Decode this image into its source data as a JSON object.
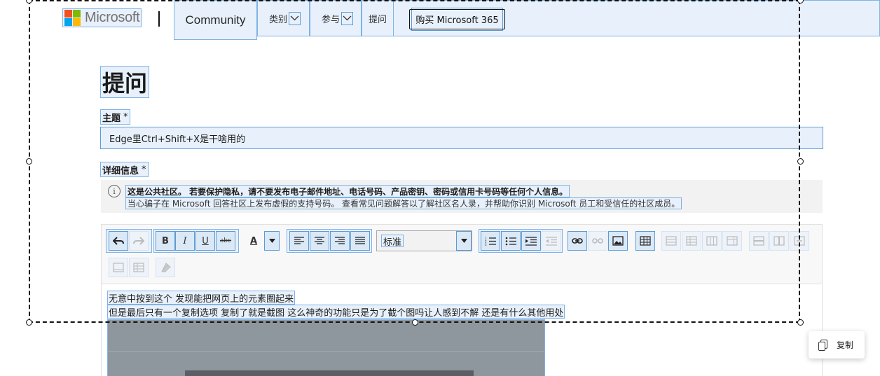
{
  "header": {
    "logo_text": "Microsoft",
    "nav": {
      "community": "Community",
      "categories": "类别",
      "participate": "参与",
      "ask": "提问",
      "buy": "购买 Microsoft 365"
    }
  },
  "form": {
    "title": "提问",
    "subject_label": "主题",
    "subject_required": "*",
    "subject_value": "Edge里Ctrl+Shift+X是干啥用的",
    "details_label": "详细信息",
    "details_required": "*",
    "notice_line1": "这是公共社区。 若要保护隐私，请不要发布电子邮件地址、电话号码、产品密钥、密码或信用卡号码等任何个人信息。",
    "notice_line2": "当心骗子在 Microsoft 回答社区上发布虚假的支持号码。  查看常见问题解答以了解社区名人录，并帮助你识别 Microsoft 员工和受信任的社区成员。"
  },
  "editor": {
    "format_value": "标准",
    "body_line1": "无意中按到这个 发现能把网页上的元素圈起来",
    "body_line2": "但是最后只有一个复制选项 复制了就是截图 这么神奇的功能只是为了截个图吗让人感到不解 还是有什么其他用处",
    "toolbar_icons": [
      "undo-icon",
      "redo-icon",
      "bold-icon",
      "italic-icon",
      "underline-icon",
      "strikethrough-icon",
      "font-color-icon",
      "font-color-dropdown-icon",
      "align-left-icon",
      "align-center-icon",
      "align-right-icon",
      "justify-icon",
      "numbered-list-icon",
      "bullet-list-icon",
      "indent-icon",
      "outdent-icon",
      "link-icon",
      "unlink-icon",
      "image-icon",
      "table-icon"
    ],
    "toolbar_glyphs": {
      "bold": "B",
      "italic": "I",
      "underline": "U",
      "strike": "abc",
      "font_color": "A"
    }
  },
  "popup": {
    "copy_label": "复制"
  },
  "colors": {
    "accent": "#5b9bd5",
    "highlight_bg": "#e8f1fb",
    "logo_red": "#f25022",
    "logo_green": "#7fba00",
    "logo_blue": "#00a4ef",
    "logo_yellow": "#ffb900"
  }
}
